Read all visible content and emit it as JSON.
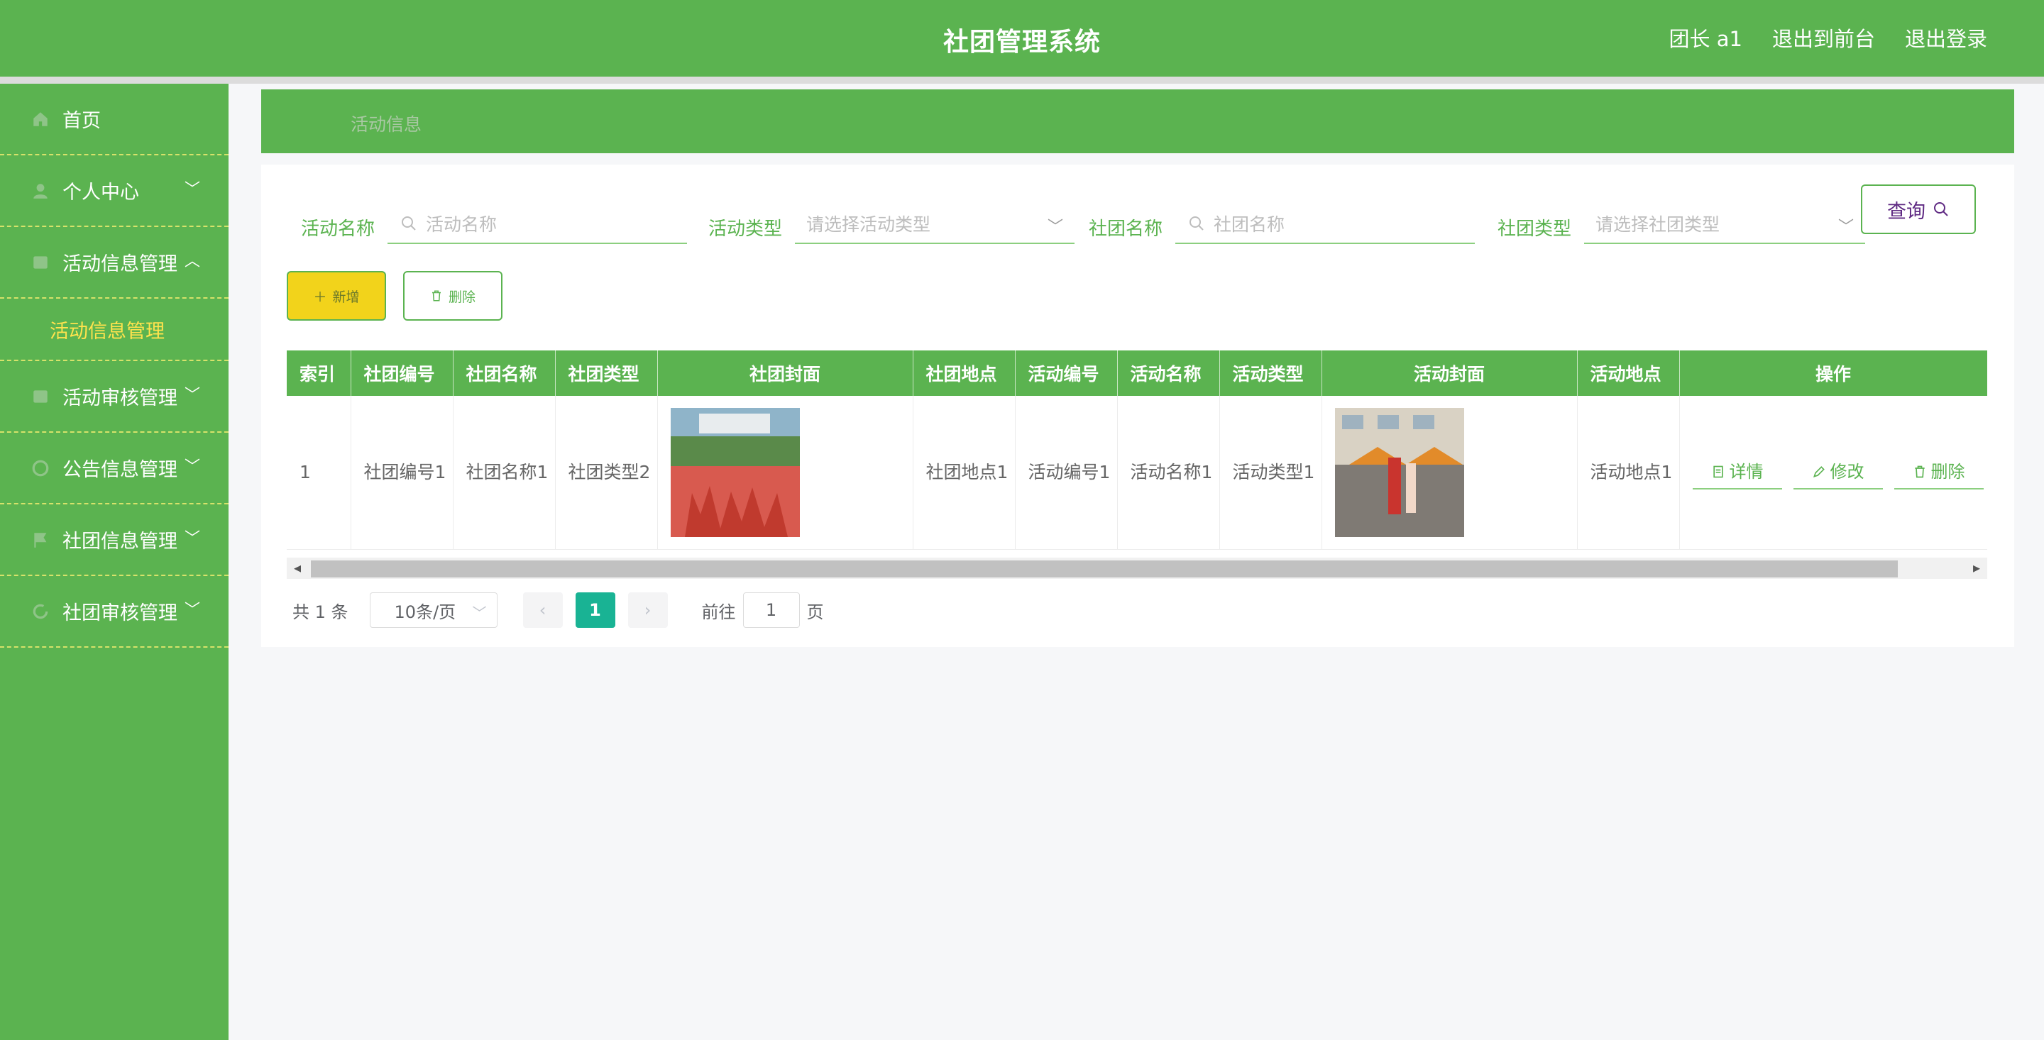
{
  "header": {
    "title": "社团管理系统",
    "user": "团长 a1",
    "front_link": "退出到前台",
    "logout": "退出登录"
  },
  "sidebar": {
    "items": [
      {
        "label": "首页",
        "icon": "home-icon"
      },
      {
        "label": "个人中心",
        "icon": "user-icon"
      },
      {
        "label": "活动信息管理",
        "icon": "list-icon",
        "expanded": true
      },
      {
        "label": "活动审核管理",
        "icon": "list-icon"
      },
      {
        "label": "公告信息管理",
        "icon": "clock-icon"
      },
      {
        "label": "社团信息管理",
        "icon": "flag-icon"
      },
      {
        "label": "社团审核管理",
        "icon": "refresh-icon"
      }
    ],
    "subitem": "活动信息管理"
  },
  "breadcrumb": {
    "current": "活动信息"
  },
  "search": {
    "activity_name_label": "活动名称",
    "activity_name_placeholder": "活动名称",
    "activity_type_label": "活动类型",
    "activity_type_placeholder": "请选择活动类型",
    "club_name_label": "社团名称",
    "club_name_placeholder": "社团名称",
    "club_type_label": "社团类型",
    "club_type_placeholder": "请选择社团类型",
    "query_button": "查询"
  },
  "actions": {
    "add": "新增",
    "delete": "删除"
  },
  "table": {
    "headers": [
      "索引",
      "社团编号",
      "社团名称",
      "社团类型",
      "社团封面",
      "社团地点",
      "活动编号",
      "活动名称",
      "活动类型",
      "活动封面",
      "活动地点",
      "操作"
    ],
    "rows": [
      {
        "index": "1",
        "club_no": "社团编号1",
        "club_name": "社团名称1",
        "club_type": "社团类型2",
        "club_location": "社团地点1",
        "activity_no": "活动编号1",
        "activity_name": "活动名称1",
        "activity_type": "活动类型1",
        "activity_location": "活动地点1"
      }
    ],
    "ops": {
      "detail": "详情",
      "edit": "修改",
      "delete": "删除"
    }
  },
  "pagination": {
    "total": "共 1 条",
    "page_size": "10条/页",
    "current_page": "1",
    "goto_label": "前往",
    "goto_value": "1",
    "page_suffix": "页"
  },
  "colors": {
    "primary": "#5bb350",
    "accent_yellow": "#f2d31b",
    "submenu": "#ffe34d",
    "pager_active": "#19b394"
  }
}
